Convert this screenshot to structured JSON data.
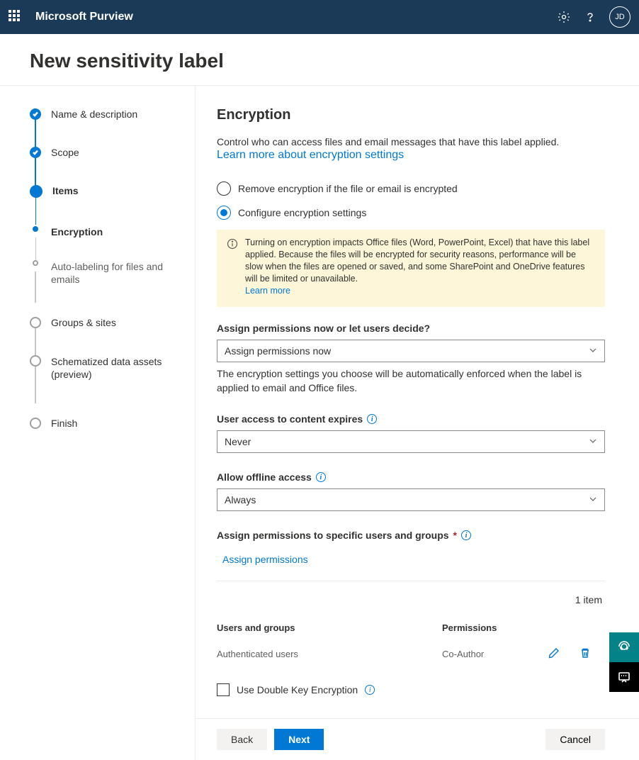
{
  "header": {
    "product": "Microsoft Purview",
    "avatar": "JD"
  },
  "page_title": "New sensitivity label",
  "steps": [
    {
      "label": "Name & description"
    },
    {
      "label": "Scope"
    },
    {
      "label": "Items"
    },
    {
      "label": "Encryption"
    },
    {
      "label": "Auto-labeling for files and emails"
    },
    {
      "label": "Groups & sites"
    },
    {
      "label": "Schematized data assets (preview)"
    },
    {
      "label": "Finish"
    }
  ],
  "main": {
    "heading": "Encryption",
    "intro": "Control who can access files and email messages that have this label applied.",
    "learn_link": "Learn more about encryption settings",
    "radio_remove": "Remove encryption if the file or email is encrypted",
    "radio_configure": "Configure encryption settings",
    "callout_text": "Turning on encryption impacts Office files (Word, PowerPoint, Excel) that have this label applied. Because the files will be encrypted for security reasons, performance will be slow when the files are opened or saved, and some SharePoint and OneDrive features will be limited or unavailable.",
    "callout_link": "Learn more",
    "assign_label": "Assign permissions now or let users decide?",
    "assign_select_value": "Assign permissions now",
    "assign_hint": "The encryption settings you choose will be automatically enforced when the label is applied to email and Office files.",
    "expiry_label": "User access to content expires",
    "expiry_value": "Never",
    "offline_label": "Allow offline access",
    "offline_value": "Always",
    "specific_label": "Assign permissions to specific users and groups",
    "assign_permissions_link": "Assign permissions",
    "item_count": "1 item",
    "col_users": "Users and groups",
    "col_perms": "Permissions",
    "row_users": "Authenticated users",
    "row_perms": "Co-Author",
    "dke_label": "Use Double Key Encryption"
  },
  "footer": {
    "back": "Back",
    "next": "Next",
    "cancel": "Cancel"
  }
}
